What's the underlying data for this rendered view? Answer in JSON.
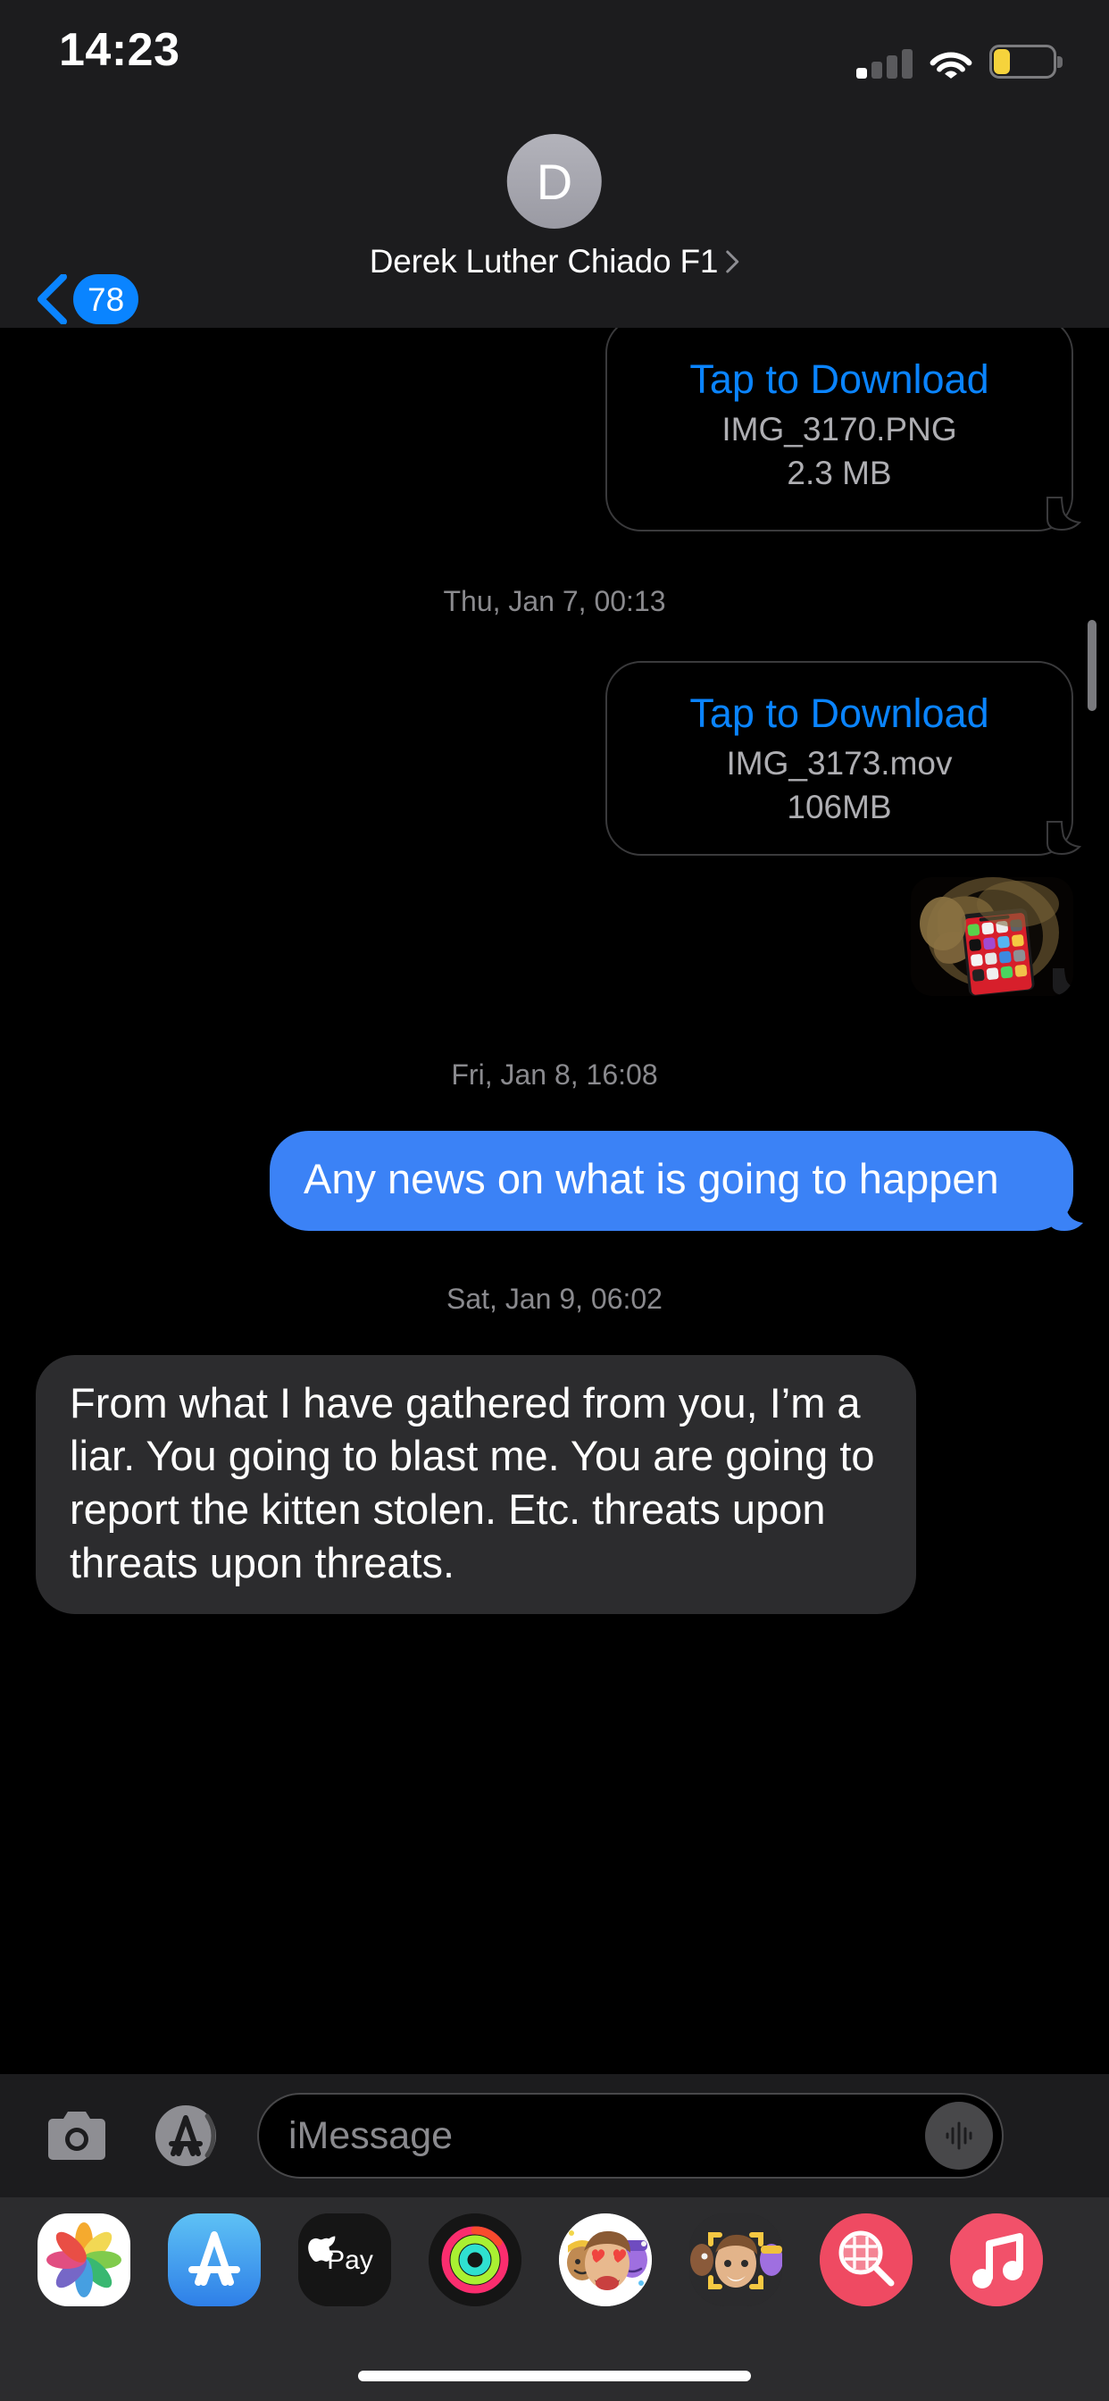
{
  "status_bar": {
    "time": "14:23",
    "signal_icon": "cellular-signal-icon",
    "signal_bars_filled": 1,
    "signal_bars_total": 4,
    "wifi_icon": "wifi-icon",
    "battery_icon": "battery-low-icon",
    "battery_color": "#f6d33c"
  },
  "nav_bar": {
    "back_icon": "chevron-left-icon",
    "back_badge_count": "78",
    "badge_color": "#0a84ff",
    "avatar_initial": "D",
    "contact_name": "Derek Luther Chiado F1",
    "detail_chevron_icon": "chevron-right-icon"
  },
  "conversation": {
    "messages": [
      {
        "kind": "attachment",
        "side": "out",
        "action_label": "Tap to Download",
        "file_name": "IMG_3170.PNG",
        "file_size": "2.3 MB"
      },
      {
        "kind": "timestamp",
        "text": "Thu, Jan 7, 00:13"
      },
      {
        "kind": "attachment",
        "side": "out",
        "action_label": "Tap to Download",
        "file_name": "IMG_3173.mov",
        "file_size": "106MB"
      },
      {
        "kind": "photo",
        "side": "out",
        "alt": "hand holding iPhone with red home screen"
      },
      {
        "kind": "timestamp",
        "text": "Fri, Jan 8, 16:08"
      },
      {
        "kind": "text",
        "side": "out",
        "text": "Any news on what is going to happen"
      },
      {
        "kind": "timestamp",
        "text": "Sat, Jan 9, 06:02"
      },
      {
        "kind": "text",
        "side": "in",
        "text": "From what I have gathered from you, I’m a liar. You going to blast me. You are going to report the kitten stolen. Etc. threats upon threats upon threats."
      }
    ],
    "sent_bubble_color": "#3b82f6",
    "received_bubble_color": "#2c2c2e",
    "link_color": "#0a84ff"
  },
  "input_bar": {
    "camera_icon": "camera-icon",
    "appstore_icon": "app-store-icon",
    "placeholder": "iMessage",
    "audio_icon": "audio-waveform-icon"
  },
  "app_drawer": {
    "apps": [
      {
        "name": "photos-app-icon",
        "label": "Photos"
      },
      {
        "name": "app-store-app-icon",
        "label": "App Store"
      },
      {
        "name": "apple-pay-app-icon",
        "label": "Apple Pay"
      },
      {
        "name": "fitness-app-icon",
        "label": "Fitness"
      },
      {
        "name": "memoji-stickers-app-icon",
        "label": "Memoji Stickers"
      },
      {
        "name": "memoji-app-icon",
        "label": "Memoji"
      },
      {
        "name": "images-app-icon",
        "label": "#images"
      },
      {
        "name": "music-app-icon",
        "label": "Music"
      }
    ]
  },
  "home_indicator": "home-indicator"
}
